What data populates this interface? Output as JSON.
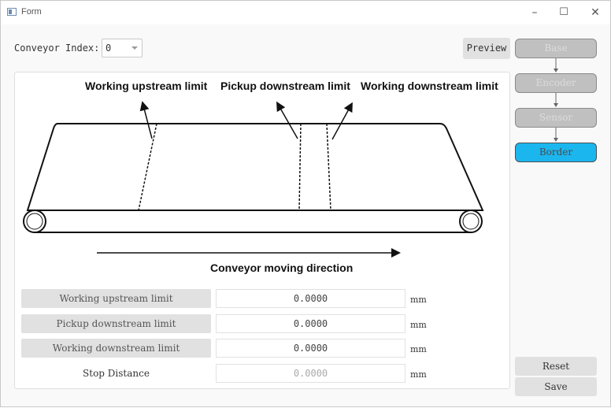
{
  "window": {
    "title": "Form",
    "minimize_icon": "minimize-icon",
    "maximize_icon": "maximize-icon",
    "close_icon": "close-icon"
  },
  "toolbar": {
    "conveyor_index_label": "Conveyor Index:",
    "conveyor_index_value": "0",
    "preview_label": "Preview"
  },
  "steps": [
    {
      "label": "Base",
      "active": false
    },
    {
      "label": "Encoder",
      "active": false
    },
    {
      "label": "Sensor",
      "active": false
    },
    {
      "label": "Border",
      "active": true
    }
  ],
  "colors": {
    "active_step": "#1cb6ef",
    "inactive_step": "#c0c0c0"
  },
  "diagram": {
    "label_working_upstream": "Working upstream limit",
    "label_pickup_downstream": "Pickup downstream limit",
    "label_working_downstream": "Working  downstream limit",
    "direction_label": "Conveyor moving direction"
  },
  "fields": [
    {
      "label": "Working upstream limit",
      "value": "0.0000",
      "unit": "mm",
      "enabled": true
    },
    {
      "label": "Pickup downstream limit",
      "value": "0.0000",
      "unit": "mm",
      "enabled": true
    },
    {
      "label": "Working downstream limit",
      "value": "0.0000",
      "unit": "mm",
      "enabled": true
    },
    {
      "label": "Stop Distance",
      "value": "0.0000",
      "unit": "mm",
      "enabled": false
    }
  ],
  "actions": {
    "reset_label": "Reset",
    "save_label": "Save"
  }
}
